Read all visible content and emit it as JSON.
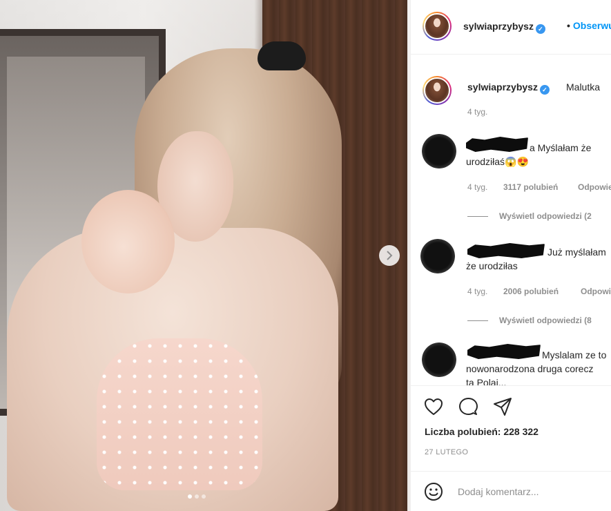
{
  "post": {
    "username": "sylwiaprzybysz",
    "follow_label": "Obserwuj",
    "separator": "•",
    "caption": {
      "username": "sylwiaprzybysz",
      "text": "Malutka",
      "time": "4 tyg."
    },
    "carousel": {
      "slide_count": 3,
      "active_index": 0
    },
    "comments": [
      {
        "text": "a Myślałam że urodziłaś😱😍",
        "time": "4 tyg.",
        "likes": "3117 polubień",
        "reply_label": "Odpowiedz",
        "view_replies": "Wyświetl odpowiedzi (2"
      },
      {
        "text": "Już myślałam że urodziłas",
        "time": "4 tyg.",
        "likes": "2006 polubień",
        "reply_label": "Odpowiedz",
        "view_replies": "Wyświetl odpowiedzi (8"
      },
      {
        "text": "Myslalam ze to nowonarodzona druga corecz",
        "line3": "ta Polaj..."
      }
    ],
    "likes_summary": "Liczba polubień: 228 322",
    "date": "27 LUTEGO",
    "add_comment_placeholder": "Dodaj komentarz..."
  },
  "icons": [
    "heart-icon",
    "comment-icon",
    "share-icon",
    "emoji-icon",
    "chevron-right-icon",
    "verified-icon"
  ],
  "colors": {
    "link": "#0095f6",
    "verified": "#3897f0",
    "muted": "#8e8e8e",
    "text": "#262626"
  }
}
